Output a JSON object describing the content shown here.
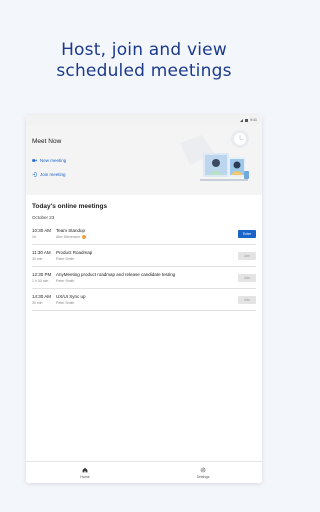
{
  "headline": {
    "line1": "Host, join and view",
    "line2": "scheduled meetings"
  },
  "status_bar": {
    "time": "9:41"
  },
  "hero": {
    "title": "Meet Now",
    "new_meeting": "New meeting",
    "join_meeting": "Join meeting"
  },
  "meetings": {
    "title": "Today's online meetings",
    "date": "October 23",
    "rows": [
      {
        "time": "10:30 AM",
        "duration": "1h",
        "title": "Team Standup",
        "host": "Alex Stevenson",
        "button": "Enter",
        "button_type": "enter"
      },
      {
        "time": "11:30 AM",
        "duration": "30 min",
        "title": "Product Roadmap",
        "host": "Peter Smith",
        "button": "Join",
        "button_type": "join"
      },
      {
        "time": "12:30 PM",
        "duration": "1 h 30 min",
        "title": "AnyMeeting product roadmap and release candidate testing",
        "host": "Peter Smith",
        "button": "Join",
        "button_type": "join"
      },
      {
        "time": "14:30 AM",
        "duration": "30 min",
        "title": "UX/UI Sync up",
        "host": "Peter Smith",
        "button": "Join",
        "button_type": "join"
      }
    ]
  },
  "tabbar": {
    "home": "Home",
    "settings": "Settings"
  },
  "colors": {
    "accent": "#1a64c8",
    "headline": "#1b3a8c",
    "background": "#f3f6fb"
  }
}
